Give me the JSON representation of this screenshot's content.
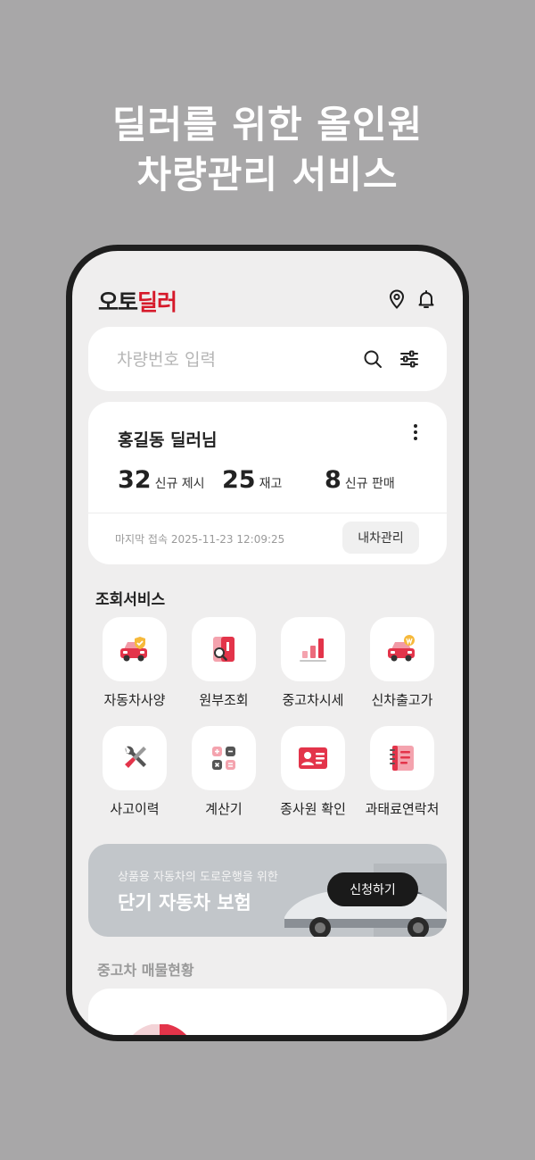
{
  "promo": {
    "headline_line1": "딜러를 위한 올인원",
    "headline_line2": "차량관리 서비스"
  },
  "app": {
    "logo_part1": "오토",
    "logo_part2": "딜러",
    "brand_color": "#d6192a",
    "top_icons": [
      "location-pin-icon",
      "bell-icon"
    ]
  },
  "search": {
    "placeholder": "차량번호 입력",
    "value": ""
  },
  "dealer_card": {
    "name": "홍길동 딜러님",
    "stats": [
      {
        "value": "32",
        "label": "신규 제시"
      },
      {
        "value": "25",
        "label": "재고"
      },
      {
        "value": "8",
        "label": "신규 판매"
      }
    ],
    "last_login": "마지막 접속 2025-11-23 12:09:25",
    "manage_label": "내차관리"
  },
  "services": {
    "title": "조회서비스",
    "items": [
      {
        "label": "자동차사양",
        "icon": "car-spec-icon"
      },
      {
        "label": "원부조회",
        "icon": "document-search-icon"
      },
      {
        "label": "중고차시세",
        "icon": "bar-chart-icon"
      },
      {
        "label": "신차출고가",
        "icon": "car-price-icon"
      },
      {
        "label": "사고이력",
        "icon": "wrench-screwdriver-icon"
      },
      {
        "label": "계산기",
        "icon": "calculator-icon"
      },
      {
        "label": "종사원 확인",
        "icon": "id-card-icon"
      },
      {
        "label": "과태료연락처",
        "icon": "notebook-icon"
      }
    ]
  },
  "banner": {
    "subtitle": "상품용 자동차의 도로운행을 위한",
    "title": "단기 자동차 보험",
    "button_label": "신청하기"
  },
  "inventory": {
    "title": "중고차 매물현황"
  }
}
